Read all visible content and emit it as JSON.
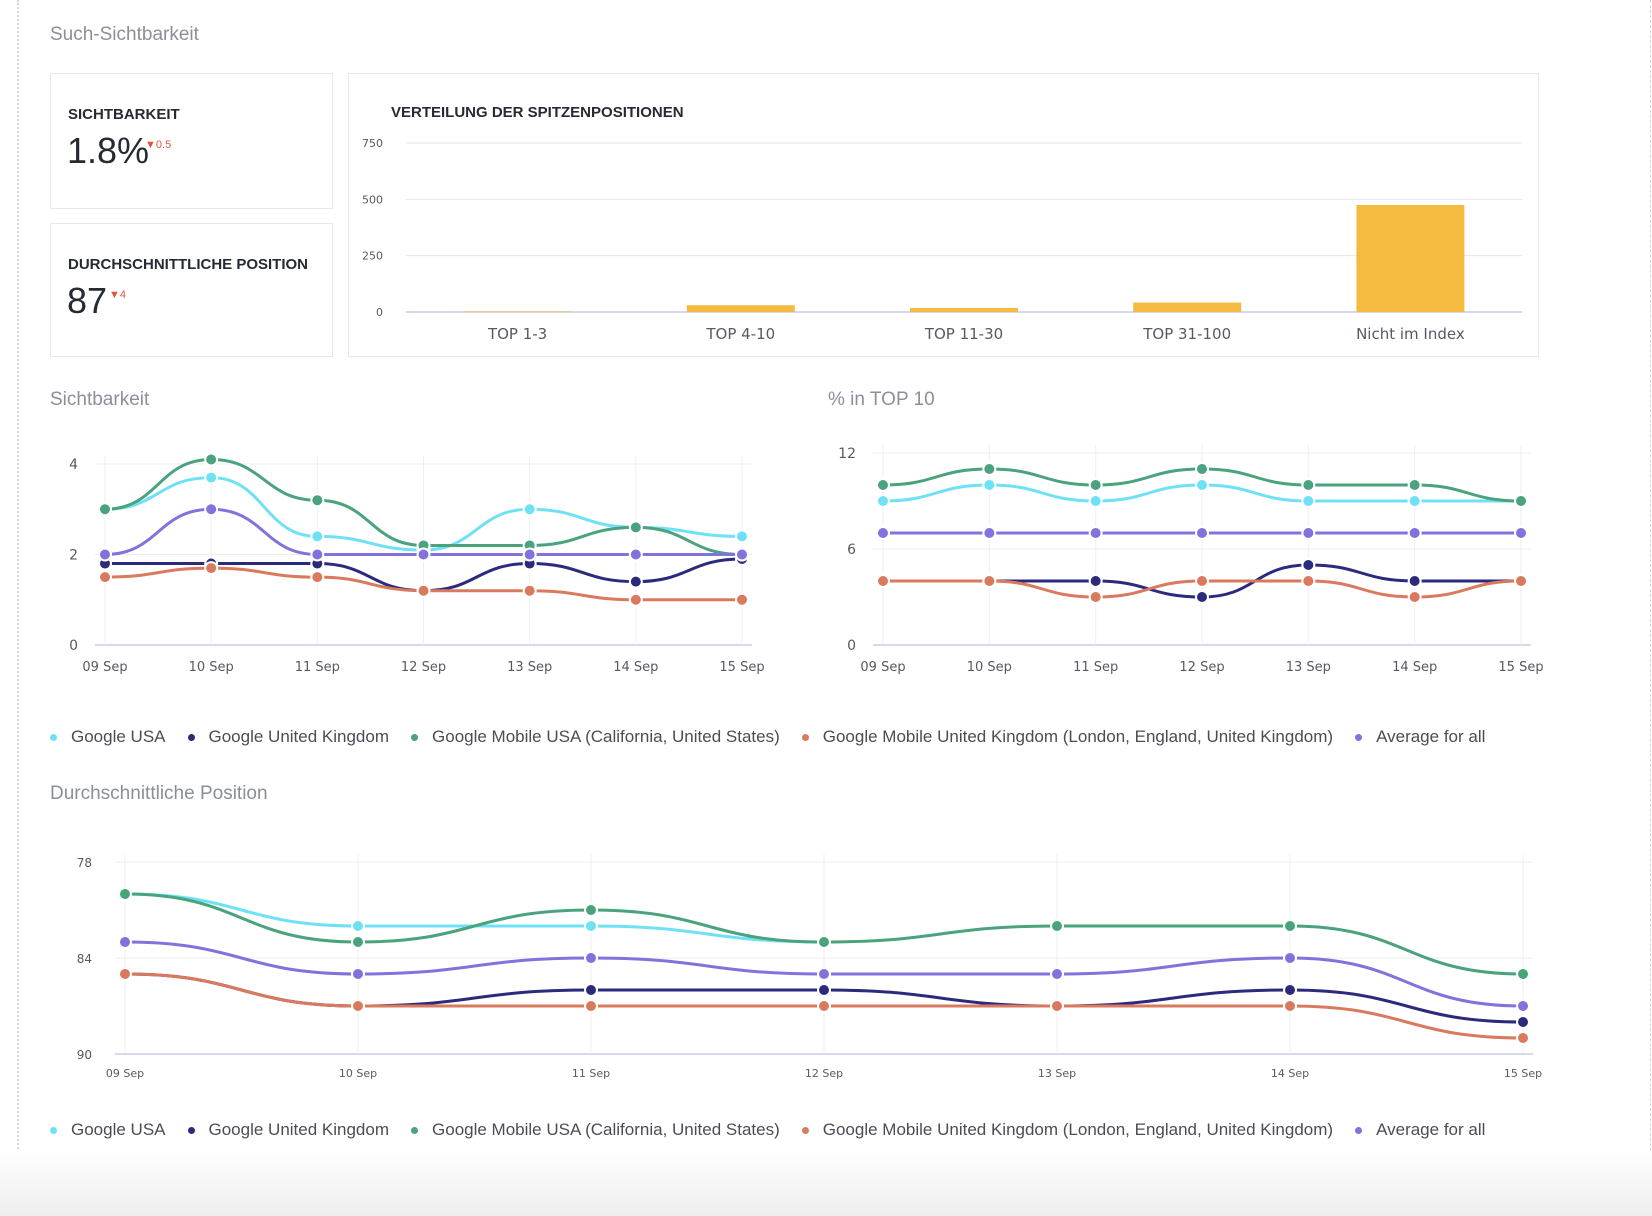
{
  "page": {
    "section_title": "Such-Sichtbarkeit"
  },
  "kpis": {
    "visibility": {
      "label": "SICHTBARKEIT",
      "value": "1.8%",
      "delta": "0.5",
      "delta_direction": "down"
    },
    "avg_position": {
      "label": "DURCHSCHNITTLICHE POSITION",
      "value": "87",
      "delta": "4",
      "delta_direction": "down"
    }
  },
  "series_meta": [
    {
      "name": "Google USA",
      "color": "#6fe1f7"
    },
    {
      "name": "Google United Kingdom",
      "color": "#2b2a7c"
    },
    {
      "name": "Google Mobile USA (California, United States)",
      "color": "#4aa37c"
    },
    {
      "name": "Google Mobile United Kingdom (London, England, United Kingdom)",
      "color": "#d97a5f"
    },
    {
      "name": "Average for all",
      "color": "#8272dc"
    }
  ],
  "colors": {
    "bar": "#f5bb41",
    "delta_down": "#e5533d"
  },
  "chart_data": [
    {
      "id": "distribution",
      "type": "bar",
      "title": "VERTEILUNG DER SPITZENPOSITIONEN",
      "categories": [
        "TOP 1-3",
        "TOP 4-10",
        "TOP 11-30",
        "TOP 31-100",
        "Nicht im Index"
      ],
      "values": [
        2,
        30,
        18,
        42,
        475
      ],
      "ylim": [
        0,
        750
      ],
      "yticks": [
        "0",
        "250",
        "500",
        "750"
      ],
      "xlabel": "",
      "ylabel": "",
      "grid": true
    },
    {
      "id": "visibility",
      "type": "line",
      "title": "Sichtbarkeit",
      "x": [
        "09 Sep",
        "10 Sep",
        "11 Sep",
        "12 Sep",
        "13 Sep",
        "14 Sep",
        "15 Sep"
      ],
      "ylim": [
        0,
        4
      ],
      "yticks": [
        "0",
        "2",
        "4"
      ],
      "inverted": false,
      "grid": true,
      "series": [
        {
          "name": "Google USA",
          "values": [
            3.0,
            3.7,
            2.4,
            2.1,
            3.0,
            2.6,
            2.4
          ]
        },
        {
          "name": "Google United Kingdom",
          "values": [
            1.8,
            1.8,
            1.8,
            1.2,
            1.8,
            1.4,
            1.9
          ]
        },
        {
          "name": "Google Mobile USA (California, United States)",
          "values": [
            3.0,
            4.1,
            3.2,
            2.2,
            2.2,
            2.6,
            2.0
          ]
        },
        {
          "name": "Google Mobile United Kingdom (London, England, United Kingdom)",
          "values": [
            1.5,
            1.7,
            1.5,
            1.2,
            1.2,
            1.0,
            1.0
          ]
        },
        {
          "name": "Average for all",
          "values": [
            2.0,
            3.0,
            2.0,
            2.0,
            2.0,
            2.0,
            2.0
          ]
        }
      ]
    },
    {
      "id": "top10",
      "type": "line",
      "title": "% in TOP 10",
      "x": [
        "09 Sep",
        "10 Sep",
        "11 Sep",
        "12 Sep",
        "13 Sep",
        "14 Sep",
        "15 Sep"
      ],
      "ylim": [
        0,
        12
      ],
      "yticks": [
        "0",
        "6",
        "12"
      ],
      "inverted": false,
      "grid": true,
      "series": [
        {
          "name": "Google USA",
          "values": [
            9,
            10,
            9,
            10,
            9,
            9,
            9
          ]
        },
        {
          "name": "Google United Kingdom",
          "values": [
            4,
            4,
            4,
            3,
            5,
            4,
            4
          ]
        },
        {
          "name": "Google Mobile USA (California, United States)",
          "values": [
            10,
            11,
            10,
            11,
            10,
            10,
            9
          ]
        },
        {
          "name": "Google Mobile United Kingdom (London, England, United Kingdom)",
          "values": [
            4,
            4,
            3,
            4,
            4,
            3,
            4
          ]
        },
        {
          "name": "Average for all",
          "values": [
            7,
            7,
            7,
            7,
            7,
            7,
            7
          ]
        }
      ]
    },
    {
      "id": "avgpos",
      "type": "line",
      "title": "Durchschnittliche Position",
      "x": [
        "09 Sep",
        "10 Sep",
        "11 Sep",
        "12 Sep",
        "13 Sep",
        "14 Sep",
        "15 Sep"
      ],
      "ylim": [
        78,
        90
      ],
      "yticks": [
        "78",
        "84",
        "90"
      ],
      "inverted": true,
      "grid": true,
      "series": [
        {
          "name": "Google USA",
          "values": [
            80,
            82,
            82,
            83,
            null,
            null,
            null
          ]
        },
        {
          "name": "Google United Kingdom",
          "values": [
            85,
            87,
            86,
            86,
            87,
            86,
            88
          ]
        },
        {
          "name": "Google Mobile USA (California, United States)",
          "values": [
            80,
            83,
            81,
            83,
            82,
            82,
            85
          ]
        },
        {
          "name": "Google Mobile United Kingdom (London, England, United Kingdom)",
          "values": [
            85,
            87,
            87,
            87,
            87,
            87,
            89
          ]
        },
        {
          "name": "Average for all",
          "values": [
            83,
            85,
            84,
            85,
            85,
            84,
            87
          ]
        }
      ]
    }
  ]
}
